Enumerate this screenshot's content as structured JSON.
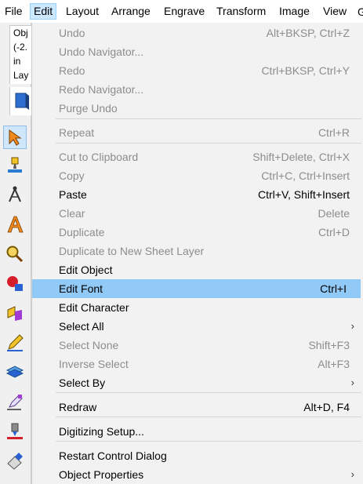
{
  "menubar": {
    "items": [
      {
        "label": "File"
      },
      {
        "label": "Edit"
      },
      {
        "label": "Layout"
      },
      {
        "label": "Arrange"
      },
      {
        "label": "Engrave"
      },
      {
        "label": "Transform"
      },
      {
        "label": "Image"
      },
      {
        "label": "View"
      }
    ]
  },
  "left_panel": {
    "info_lines": [
      "Obj",
      "(-2.",
      "in",
      "Lay"
    ]
  },
  "edit_menu": {
    "items": [
      {
        "label": "Undo",
        "shortcut": "Alt+BKSP, Ctrl+Z",
        "enabled": false
      },
      {
        "label": "Undo Navigator...",
        "shortcut": "",
        "enabled": false
      },
      {
        "label": "Redo",
        "shortcut": "Ctrl+BKSP, Ctrl+Y",
        "enabled": false
      },
      {
        "label": "Redo Navigator...",
        "shortcut": "",
        "enabled": false
      },
      {
        "label": "Purge Undo",
        "shortcut": "",
        "enabled": false
      },
      {
        "label": "Repeat",
        "shortcut": "Ctrl+R",
        "enabled": false
      },
      {
        "label": "Cut to Clipboard",
        "shortcut": "Shift+Delete, Ctrl+X",
        "enabled": false
      },
      {
        "label": "Copy",
        "shortcut": "Ctrl+C, Ctrl+Insert",
        "enabled": false
      },
      {
        "label": "Paste",
        "shortcut": "Ctrl+V, Shift+Insert",
        "enabled": true
      },
      {
        "label": "Clear",
        "shortcut": "Delete",
        "enabled": false
      },
      {
        "label": "Duplicate",
        "shortcut": "Ctrl+D",
        "enabled": false
      },
      {
        "label": "Duplicate to New Sheet Layer",
        "shortcut": "",
        "enabled": false
      },
      {
        "label": "Edit Object",
        "shortcut": "",
        "enabled": true
      },
      {
        "label": "Edit Font",
        "shortcut": "Ctrl+I",
        "enabled": true,
        "highlighted": true
      },
      {
        "label": "Edit Character",
        "shortcut": "",
        "enabled": true
      },
      {
        "label": "Select All",
        "shortcut": "",
        "enabled": true,
        "submenu": true
      },
      {
        "label": "Select None",
        "shortcut": "Shift+F3",
        "enabled": false
      },
      {
        "label": "Inverse Select",
        "shortcut": "Alt+F3",
        "enabled": false
      },
      {
        "label": "Select By",
        "shortcut": "",
        "enabled": true,
        "submenu": true
      },
      {
        "label": "Redraw",
        "shortcut": "Alt+D, F4",
        "enabled": true
      },
      {
        "label": "Digitizing Setup...",
        "shortcut": "",
        "enabled": true
      },
      {
        "label": "Restart Control Dialog",
        "shortcut": "",
        "enabled": true
      },
      {
        "label": "Object Properties",
        "shortcut": "",
        "enabled": true,
        "submenu": true
      }
    ]
  },
  "colors": {
    "highlight": "#91c9f7",
    "menu_bg": "#f2f2f2",
    "disabled_text": "#8d8d8d",
    "active_menu_bg": "#cce8ff"
  }
}
